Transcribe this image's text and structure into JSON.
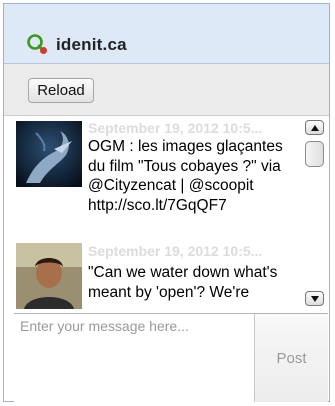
{
  "header": {
    "title": "idenit.ca",
    "logo_icon": "speech-bubble-logo-icon",
    "accent": "#3a9a1e"
  },
  "toolbar": {
    "reload_label": "Reload"
  },
  "feed": {
    "items": [
      {
        "time": "September 19, 2012 10:5...",
        "text": "OGM : les images glaçantes du film \"Tous cobayes ?\" via @Cityzencat | @scoopit http://sco.lt/7GqQF7",
        "avatar": "dragon-avatar"
      },
      {
        "time": "September 19, 2012 10:5...",
        "text": "\"Can we water down what's meant by 'open'? We're",
        "avatar": "person-avatar"
      }
    ]
  },
  "scrollbar": {
    "up_icon": "arrow-up-icon",
    "down_icon": "arrow-down-icon"
  },
  "composer": {
    "placeholder": "Enter your message here...",
    "post_label": "Post"
  }
}
